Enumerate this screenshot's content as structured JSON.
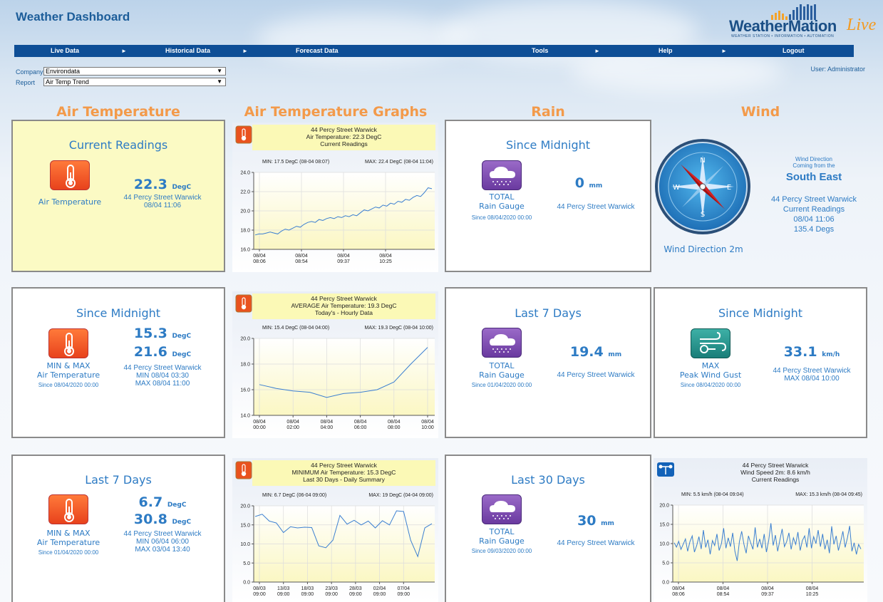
{
  "app": {
    "title": "Weather Dashboard"
  },
  "logo": {
    "brand": "WeatherMation",
    "live": "Live",
    "tagline": "WEATHER STATION • INFORMATION • AUTOMATION"
  },
  "nav": [
    {
      "label": "Live Data"
    },
    {
      "label": "Historical Data"
    },
    {
      "label": "Forecast Data"
    },
    {
      "label": "Tools"
    },
    {
      "label": "Help"
    },
    {
      "label": "Logout"
    }
  ],
  "selectors": {
    "company_label": "Company",
    "company_value": "Environdata",
    "report_label": "Report",
    "report_value": "Air Temp Trend"
  },
  "user": "User: Administrator",
  "columns": {
    "c1": "Air Temperature",
    "c2": "Air Temperature Graphs",
    "c3": "Rain",
    "c4": "Wind"
  },
  "air_current": {
    "title": "Current Readings",
    "label": "Air Temperature",
    "value": "22.3",
    "unit": "DegC",
    "station": "44 Percy Street Warwick",
    "time": "08/04 11:06"
  },
  "air_midnight": {
    "title": "Since Midnight",
    "label1": "MIN & MAX",
    "label2": "Air Temperature",
    "since": "Since 08/04/2020 00:00",
    "min": "15.3",
    "max": "21.6",
    "unit": "DegC",
    "station": "44 Percy Street Warwick",
    "min_time": "MIN 08/04 03:30",
    "max_time": "MAX 08/04 11:00"
  },
  "air_7days": {
    "title": "Last 7 Days",
    "label1": "MIN & MAX",
    "label2": "Air Temperature",
    "since": "Since 01/04/2020 00:00",
    "min": "6.7",
    "max": "30.8",
    "unit": "DegC",
    "station": "44 Percy Street Warwick",
    "min_time": "MIN 06/04 06:00",
    "max_time": "MAX 03/04 13:40"
  },
  "rain_midnight": {
    "title": "Since Midnight",
    "label1": "TOTAL",
    "label2": "Rain Gauge",
    "since": "Since 08/04/2020 00:00",
    "value": "0",
    "unit": "mm",
    "station": "44 Percy Street Warwick"
  },
  "rain_7days": {
    "title": "Last 7 Days",
    "label1": "TOTAL",
    "label2": "Rain Gauge",
    "since": "Since 01/04/2020 00:00",
    "value": "19.4",
    "unit": "mm",
    "station": "44 Percy Street Warwick"
  },
  "rain_30days": {
    "title": "Last 30 Days",
    "label1": "TOTAL",
    "label2": "Rain Gauge",
    "since": "Since 09/03/2020 00:00",
    "value": "30",
    "unit": "mm",
    "station": "44 Percy Street Warwick"
  },
  "wind_direction": {
    "caption": "Wind Direction 2m",
    "head1": "Wind Direction",
    "head2": "Coming from the",
    "direction": "South East",
    "station": "44 Percy Street Warwick",
    "readings": "Current Readings",
    "time": "08/04 11:06",
    "degs": "135.4 Degs",
    "degrees": 135.4
  },
  "wind_gust": {
    "title": "Since Midnight",
    "label1": "MAX",
    "label2": "Peak Wind Gust",
    "since": "Since 08/04/2020 00:00",
    "value": "33.1",
    "unit": "km/h",
    "station": "44 Percy Street Warwick",
    "max_time": "MAX 08/04 10:00"
  },
  "chart_data": [
    {
      "type": "line",
      "title": "44 Percy Street Warwick",
      "subtitle1": "Air Temperature: 22.3 DegC",
      "subtitle2": "Current Readings",
      "min_label": "MIN: 17.5 DegC (08-04 08:07)",
      "max_label": "MAX: 22.4 DegC (08-04 11:04)",
      "ylim": [
        16.0,
        24.0
      ],
      "yticks": [
        "16.0",
        "18.0",
        "20.0",
        "22.0",
        "24.0"
      ],
      "xticks": [
        [
          "08/04",
          "08:06"
        ],
        [
          "08/04",
          "08:54"
        ],
        [
          "08/04",
          "09:37"
        ],
        [
          "08/04",
          "10:25"
        ]
      ],
      "values": [
        17.5,
        17.6,
        17.6,
        17.7,
        17.8,
        17.7,
        17.6,
        17.9,
        18.1,
        18.0,
        18.2,
        18.4,
        18.3,
        18.6,
        18.8,
        18.9,
        18.8,
        19.1,
        19.0,
        19.2,
        19.3,
        19.2,
        19.4,
        19.3,
        19.5,
        19.4,
        19.6,
        19.5,
        19.8,
        20.1,
        20.0,
        20.2,
        20.4,
        20.3,
        20.6,
        20.5,
        20.8,
        20.7,
        21.0,
        20.9,
        21.2,
        21.1,
        21.4,
        21.6,
        21.5,
        21.9,
        22.4,
        22.3
      ]
    },
    {
      "type": "line",
      "title": "44 Percy Street Warwick",
      "subtitle1": "AVERAGE Air Temperature: 19.3 DegC",
      "subtitle2": "Today's - Hourly Data",
      "min_label": "MIN: 15.4 DegC (08-04 04:00)",
      "max_label": "MAX: 19.3 DegC (08-04 10:00)",
      "ylim": [
        14.0,
        20.0
      ],
      "yticks": [
        "14.0",
        "16.0",
        "18.0",
        "20.0"
      ],
      "xticks": [
        [
          "08/04",
          "00:00"
        ],
        [
          "08/04",
          "02:00"
        ],
        [
          "08/04",
          "04:00"
        ],
        [
          "08/04",
          "06:00"
        ],
        [
          "08/04",
          "08:00"
        ],
        [
          "08/04",
          "10:00"
        ]
      ],
      "values": [
        16.4,
        16.1,
        15.9,
        15.8,
        15.4,
        15.7,
        15.8,
        16.0,
        16.6,
        18.0,
        19.3
      ]
    },
    {
      "type": "line",
      "title": "44 Percy Street Warwick",
      "subtitle1": "MINIMUM Air Temperature: 15.3 DegC",
      "subtitle2": "Last 30 Days - Daily Summary",
      "min_label": "MIN: 6.7 DegC (06-04 09:00)",
      "max_label": "MAX: 19 DegC (04-04 09:00)",
      "ylim": [
        0.0,
        20.0
      ],
      "yticks": [
        "0.0",
        "5.0",
        "10.0",
        "15.0",
        "20.0"
      ],
      "xticks": [
        [
          "08/03",
          "09:00"
        ],
        [
          "13/03",
          "09:00"
        ],
        [
          "18/03",
          "09:00"
        ],
        [
          "23/03",
          "09:00"
        ],
        [
          "28/03",
          "09:00"
        ],
        [
          "02/04",
          "09:00"
        ],
        [
          "07/04",
          "09:00"
        ]
      ],
      "values": [
        17.2,
        17.8,
        16.0,
        15.5,
        13.0,
        14.5,
        14.2,
        14.4,
        14.3,
        9.5,
        9.0,
        11.0,
        17.5,
        15.2,
        16.2,
        15.0,
        16.0,
        14.2,
        16.1,
        15.0,
        18.7,
        18.5,
        11.0,
        6.7,
        14.2,
        15.3
      ]
    },
    {
      "type": "line",
      "title": "44 Percy Street Warwick",
      "subtitle1": "Wind Speed 2m: 8.6 km/h",
      "subtitle2": "Current Readings",
      "min_label": "MIN: 5.5 km/h (08-04 09:04)",
      "max_label": "MAX: 15.3 km/h (08-04 09:45)",
      "ylim": [
        0.0,
        20.0
      ],
      "yticks": [
        "0.0",
        "5.0",
        "10.0",
        "15.0",
        "20.0"
      ],
      "xticks": [
        [
          "08/04",
          "08:06"
        ],
        [
          "08/04",
          "08:54"
        ],
        [
          "08/04",
          "09:37"
        ],
        [
          "08/04",
          "10:25"
        ]
      ],
      "values": [
        10.2,
        9.1,
        10.6,
        8.5,
        9.8,
        11.2,
        8.0,
        10.5,
        12.0,
        7.8,
        9.5,
        11.8,
        8.6,
        13.5,
        9.0,
        11.0,
        7.2,
        10.8,
        9.5,
        12.5,
        8.2,
        10.0,
        14.0,
        8.8,
        11.5,
        9.2,
        12.8,
        8.0,
        5.5,
        10.5,
        13.2,
        9.8,
        7.5,
        12.0,
        10.2,
        8.5,
        14.2,
        9.0,
        11.2,
        8.8,
        12.5,
        7.8,
        10.8,
        15.3,
        9.5,
        12.2,
        8.0,
        11.0,
        13.8,
        9.2,
        10.5,
        12.8,
        8.5,
        11.5,
        9.8,
        13.0,
        8.2,
        10.8,
        12.0,
        9.0,
        14.0,
        8.8,
        11.8,
        10.0,
        13.5,
        9.2,
        12.5,
        8.5,
        11.0,
        7.5,
        14.5,
        9.8,
        12.0,
        8.2,
        10.5,
        13.2,
        9.0,
        11.5,
        14.6,
        8.0,
        10.2,
        7.2,
        9.8,
        8.6
      ]
    }
  ]
}
